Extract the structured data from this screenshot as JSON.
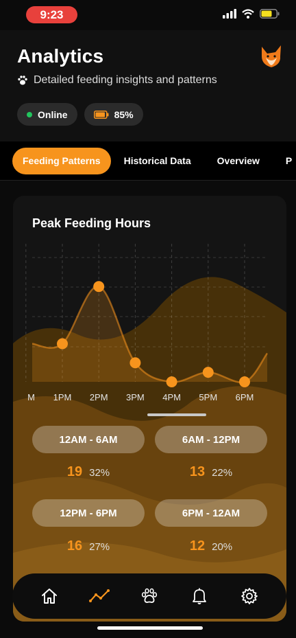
{
  "status": {
    "time": "9:23",
    "battery_color": "#f5e01f"
  },
  "header": {
    "title": "Analytics",
    "subtitle": "Detailed feeding insights and patterns",
    "chips": {
      "online": "Online",
      "battery": "85%"
    }
  },
  "tabs": [
    "Feeding Patterns",
    "Historical Data",
    "Overview",
    "P"
  ],
  "card": {
    "title": "Peak Feeding Hours"
  },
  "chart_data": {
    "type": "line",
    "categories": [
      "M",
      "1PM",
      "2PM",
      "3PM",
      "4PM",
      "5PM",
      "6PM"
    ],
    "values": [
      null,
      4,
      10,
      2,
      0,
      1,
      0
    ],
    "ylim": [
      0,
      12
    ],
    "grid": true,
    "accent": "#f7941d"
  },
  "ranges": [
    {
      "label": "12AM - 6AM",
      "count": "19",
      "pct": "32%"
    },
    {
      "label": "6AM - 12PM",
      "count": "13",
      "pct": "22%"
    },
    {
      "label": "12PM - 6PM",
      "count": "16",
      "pct": "27%"
    },
    {
      "label": "6PM - 12AM",
      "count": "12",
      "pct": "20%"
    }
  ],
  "nav": [
    "home-icon",
    "analytics-icon",
    "paw-icon",
    "bell-icon",
    "settings-icon"
  ],
  "colors": {
    "accent": "#f7941d",
    "online": "#22c55e"
  }
}
